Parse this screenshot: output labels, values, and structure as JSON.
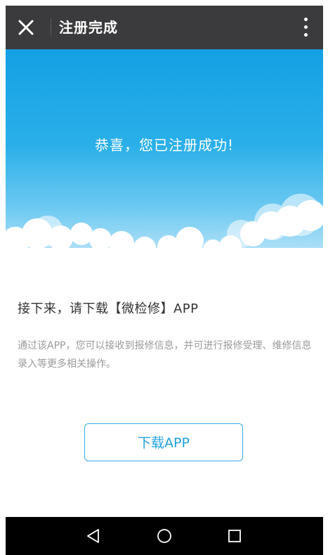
{
  "header": {
    "title": "注册完成",
    "close_icon": "close-icon",
    "more_icon": "more-vertical-icon"
  },
  "banner": {
    "message": "恭喜，您已注册成功!"
  },
  "content": {
    "heading": "接下来，请下载【微检修】APP",
    "description": "通过该APP，您可以接收到报修信息，并可进行报修受理、维修信息录入等更多相关操作。",
    "download_button": "下载APP"
  },
  "navbar": {
    "back_icon": "back-triangle-icon",
    "home_icon": "home-circle-icon",
    "recents_icon": "recents-square-icon"
  },
  "colors": {
    "title_bar": "#3b3b3d",
    "banner_top": "#14a0e4",
    "accent": "#36aee6",
    "nav_bar": "#000000"
  }
}
